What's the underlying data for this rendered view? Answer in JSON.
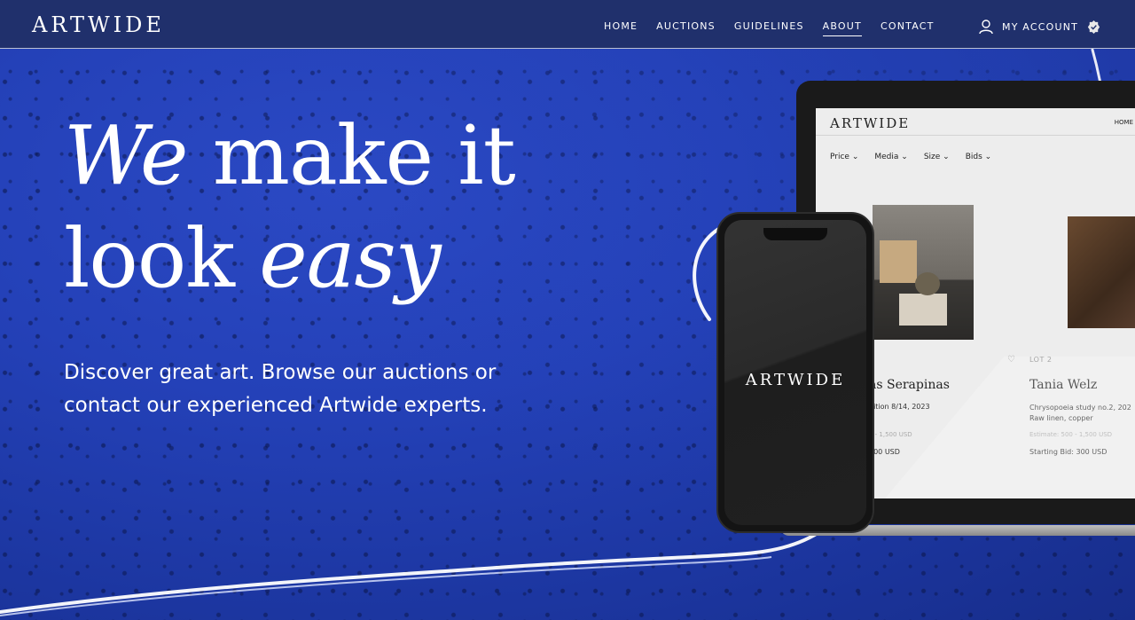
{
  "header": {
    "logo": "ARTWIDE",
    "nav": [
      {
        "label": "HOME"
      },
      {
        "label": "AUCTIONS"
      },
      {
        "label": "GUIDELINES"
      },
      {
        "label": "ABOUT",
        "active": true
      },
      {
        "label": "CONTACT"
      }
    ],
    "account_label": "MY ACCOUNT",
    "account_icon": "user-icon",
    "badge_icon": "check-badge-icon"
  },
  "hero": {
    "headline_line1_em": "We",
    "headline_line1_rest": " make it",
    "headline_line2_start": "look ",
    "headline_line2_em": "easy",
    "subtext": "Discover great art. Browse our auctions or contact our experienced Artwide experts."
  },
  "laptop_screen": {
    "logo": "ARTWIDE",
    "nav_home": "HOME",
    "filters": [
      "Price",
      "Media",
      "Size",
      "Bids"
    ],
    "lot_label": "LOT 2",
    "card1": {
      "artist": "as Serapinas",
      "meta": "dition 8/14, 2023",
      "estimate": "0 - 1,500 USD",
      "bid": "200 USD"
    },
    "card2": {
      "artist": "Tania Welz",
      "title": "Chrysopoeia study no.2, 202",
      "medium": "Raw linen, copper",
      "estimate": "Estimate: 500 - 1,500 USD",
      "bid": "Starting Bid: 300 USD"
    }
  },
  "phone": {
    "logo": "ARTWIDE"
  },
  "colors": {
    "header_bg": "#20306c",
    "hero_blue": "#2441b8",
    "text": "#ffffff"
  }
}
